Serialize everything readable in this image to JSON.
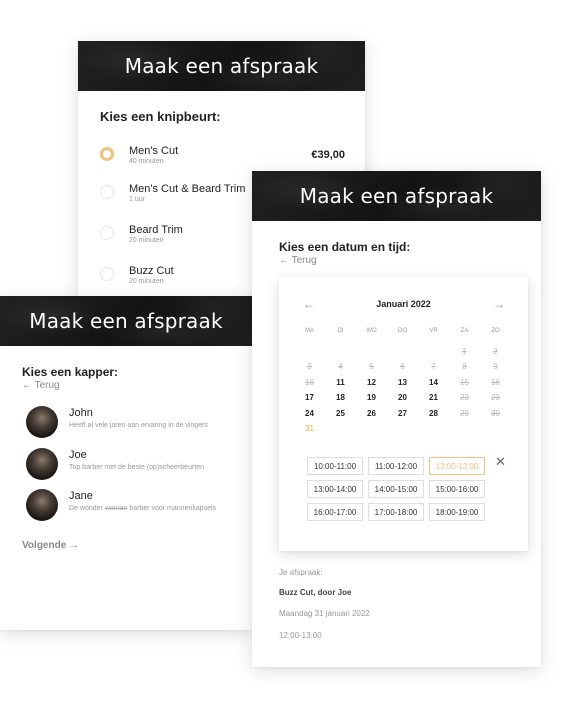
{
  "card1": {
    "header": "Maak een afspraak",
    "title": "Kies een knipbeurt:",
    "services": [
      {
        "name": "Men's Cut",
        "duration": "40 minuten",
        "price": "€39,00",
        "selected": true
      },
      {
        "name": "Men's Cut & Beard Trim",
        "duration": "1 uur",
        "price": "",
        "selected": false
      },
      {
        "name": "Beard Trim",
        "duration": "20 minuten",
        "price": "",
        "selected": false
      },
      {
        "name": "Buzz Cut",
        "duration": "20 minuten",
        "price": "",
        "selected": false
      }
    ]
  },
  "card2": {
    "header": "Maak een afspraak",
    "title": "Kies een kapper:",
    "back": "← Terug",
    "barbers": [
      {
        "name": "John",
        "desc": "Heeft al vele jaren aan ervaring in de vingers"
      },
      {
        "name": "Joe",
        "desc": "Top barber met de beste (op)scheerbeurten"
      },
      {
        "name": "Jane",
        "desc_before": "De wonder ",
        "desc_struck": "woman",
        "desc_after": " barber voor mannenkapsels"
      }
    ],
    "next": "Volgende →"
  },
  "card3": {
    "header": "Maak een afspraak",
    "title": "Kies een datum en tijd:",
    "back": "← Terug",
    "calendar": {
      "prev_icon": "←",
      "next_icon": "→",
      "month": "Januari 2022",
      "weekdays": [
        "MA",
        "DI",
        "WO",
        "DO",
        "VR",
        "ZA",
        "ZO"
      ],
      "weeks": [
        [
          {
            "d": ""
          },
          {
            "d": ""
          },
          {
            "d": ""
          },
          {
            "d": ""
          },
          {
            "d": ""
          },
          {
            "d": "1",
            "s": "past"
          },
          {
            "d": "2",
            "s": "past"
          }
        ],
        [
          {
            "d": "3",
            "s": "past"
          },
          {
            "d": "4",
            "s": "past"
          },
          {
            "d": "5",
            "s": "past"
          },
          {
            "d": "6",
            "s": "past"
          },
          {
            "d": "7",
            "s": "past"
          },
          {
            "d": "8",
            "s": "past"
          },
          {
            "d": "9",
            "s": "past"
          }
        ],
        [
          {
            "d": "10",
            "s": "past"
          },
          {
            "d": "11"
          },
          {
            "d": "12"
          },
          {
            "d": "13"
          },
          {
            "d": "14"
          },
          {
            "d": "15",
            "s": "past"
          },
          {
            "d": "16",
            "s": "past"
          }
        ],
        [
          {
            "d": "17"
          },
          {
            "d": "18"
          },
          {
            "d": "19"
          },
          {
            "d": "20"
          },
          {
            "d": "21"
          },
          {
            "d": "22",
            "s": "past"
          },
          {
            "d": "23",
            "s": "past"
          }
        ],
        [
          {
            "d": "24"
          },
          {
            "d": "25"
          },
          {
            "d": "26"
          },
          {
            "d": "27"
          },
          {
            "d": "28"
          },
          {
            "d": "29",
            "s": "past"
          },
          {
            "d": "30",
            "s": "past"
          }
        ],
        [
          {
            "d": "31",
            "s": "today"
          },
          {
            "d": ""
          },
          {
            "d": ""
          },
          {
            "d": ""
          },
          {
            "d": ""
          },
          {
            "d": ""
          },
          {
            "d": ""
          }
        ]
      ],
      "accent_color": "#f0a84a"
    },
    "time_slots": [
      [
        {
          "t": "10:00-11:00"
        },
        {
          "t": "11:00-12:00"
        },
        {
          "t": "12:00-13:00",
          "selected": true
        }
      ],
      [
        {
          "t": "13:00-14:00"
        },
        {
          "t": "14:00-15:00"
        },
        {
          "t": "15:00-16:00"
        }
      ],
      [
        {
          "t": "16:00-17:00"
        },
        {
          "t": "17:00-18:00"
        },
        {
          "t": "18:00-19:00"
        }
      ]
    ],
    "close_icon": "✕",
    "summary": {
      "label": "Je afspraak:",
      "service": "Buzz Cut, door Joe",
      "date": "Maandag 31 januari 2022",
      "time": "12:00-13:00"
    }
  }
}
